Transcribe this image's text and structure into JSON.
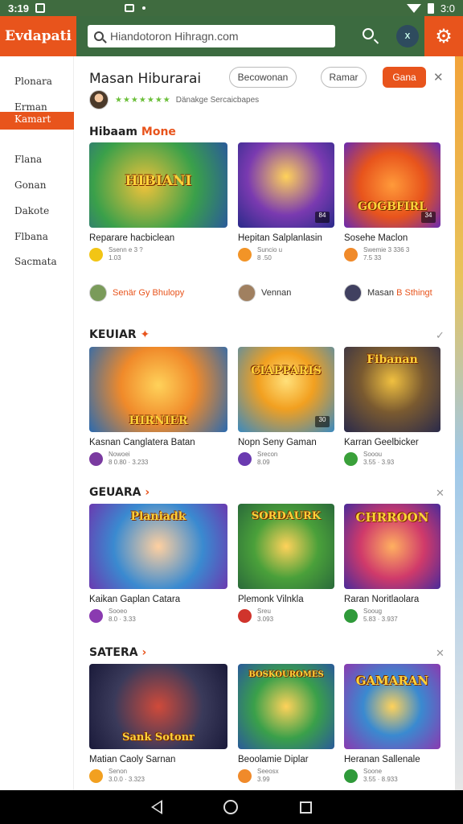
{
  "status": {
    "time": "3:19",
    "right_text": "3:0"
  },
  "app": {
    "logo": "Evdapati",
    "search_value": "Hiandotoron Hihragn.com",
    "avatar_text": "X"
  },
  "sidebar": {
    "items": [
      {
        "label": "Plonara"
      },
      {
        "label": "Erman"
      },
      {
        "label": "Kamart"
      },
      {
        "label": "Flana"
      },
      {
        "label": "Gonan"
      },
      {
        "label": "Dakote"
      },
      {
        "label": "Flbana"
      },
      {
        "label": "Sacmata"
      }
    ]
  },
  "header": {
    "title": "Masan Hiburarai",
    "buttons": {
      "outline1": "Becowonan",
      "outline2": "Ramar",
      "primary": "Gana"
    },
    "stars": "★★★★★★★",
    "meta_text": "Dänakge Sercaicbapes"
  },
  "sections": [
    {
      "title": "Hibaam",
      "title_accent": "Mone",
      "cards": [
        {
          "name": "Reparare hacbiclean",
          "sub1": "Ssenn e 3 ?",
          "sub2": "1.03",
          "badge": "",
          "thumb_text": "HIBIANI",
          "icon_color": "#f2c515"
        },
        {
          "name": "Hepitan Salplanlasin",
          "sub1": "Suncio u",
          "sub2": "8 .50",
          "badge": "84",
          "thumb_text": "",
          "icon_color": "#f29427"
        },
        {
          "name": "Sosehe Maclon",
          "sub1": "Swemie 3 336 3",
          "sub2": "7.5 33",
          "badge": "34",
          "thumb_text": "GOGBFIRL",
          "icon_color": "#f08a2a"
        }
      ],
      "creators": [
        {
          "name": "Senär Gy",
          "accent": "Bhulopy",
          "color": "#7a9b5a"
        },
        {
          "name": "Vennan",
          "accent": "",
          "color": "#a08060"
        },
        {
          "name": "Masan",
          "accent": "B Sthingt",
          "color": "#404060"
        }
      ]
    },
    {
      "title": "KEUIAR",
      "title_accent": "✦",
      "cards": [
        {
          "name": "Kasnan Canglatera Batan",
          "sub1": "Nowoei",
          "sub2": "8 0.80 · 3.233",
          "badge": "",
          "thumb_text": "HIRNIER",
          "icon_color": "#7a3aa0"
        },
        {
          "name": "Nopn Seny Gaman",
          "sub1": "Srecon",
          "sub2": "8.09",
          "badge": "30",
          "thumb_text": "CIAPPARIS",
          "icon_color": "#6a3ab0"
        },
        {
          "name": "Karran Geelbicker",
          "sub1": "Sooou",
          "sub2": "3.55 · 3.93",
          "badge": "",
          "thumb_text": "Fibanan",
          "icon_color": "#3aa03a"
        }
      ]
    },
    {
      "title": "GEUARA",
      "title_accent": "›",
      "cards": [
        {
          "name": "Kaikan Gaplan Catara",
          "sub1": "Sooeo",
          "sub2": "8.0 · 3.33",
          "badge": "",
          "thumb_text": "Planiadk",
          "icon_color": "#8a3ab0"
        },
        {
          "name": "Plemonk Vilnkla",
          "sub1": "Sreu",
          "sub2": "3.093",
          "badge": "",
          "thumb_text": "SORDAURK",
          "icon_color": "#d0342c"
        },
        {
          "name": "Raran Noritlaolara",
          "sub1": "Sooug",
          "sub2": "5.83 · 3.937",
          "badge": "",
          "thumb_text": "CHRROON",
          "icon_color": "#2f9a3a"
        }
      ]
    },
    {
      "title": "SATERA",
      "title_accent": "›",
      "cards": [
        {
          "name": "Matian Caoly Sarnan",
          "sub1": "Senon",
          "sub2": "3.0.0 · 3.323",
          "badge": "",
          "thumb_text": "Sank Sotonr",
          "icon_color": "#f2a020"
        },
        {
          "name": "Beoolamie Diplar",
          "sub1": "Seeosx",
          "sub2": "3.99",
          "badge": "",
          "thumb_text": "BOSKOUROMES",
          "icon_color": "#f08a2a"
        },
        {
          "name": "Heranan Sallenale",
          "sub1": "Soone",
          "sub2": "3.55 · 8.933",
          "badge": "",
          "thumb_text": "GAMARAN",
          "icon_color": "#2f9a3a"
        }
      ]
    }
  ]
}
